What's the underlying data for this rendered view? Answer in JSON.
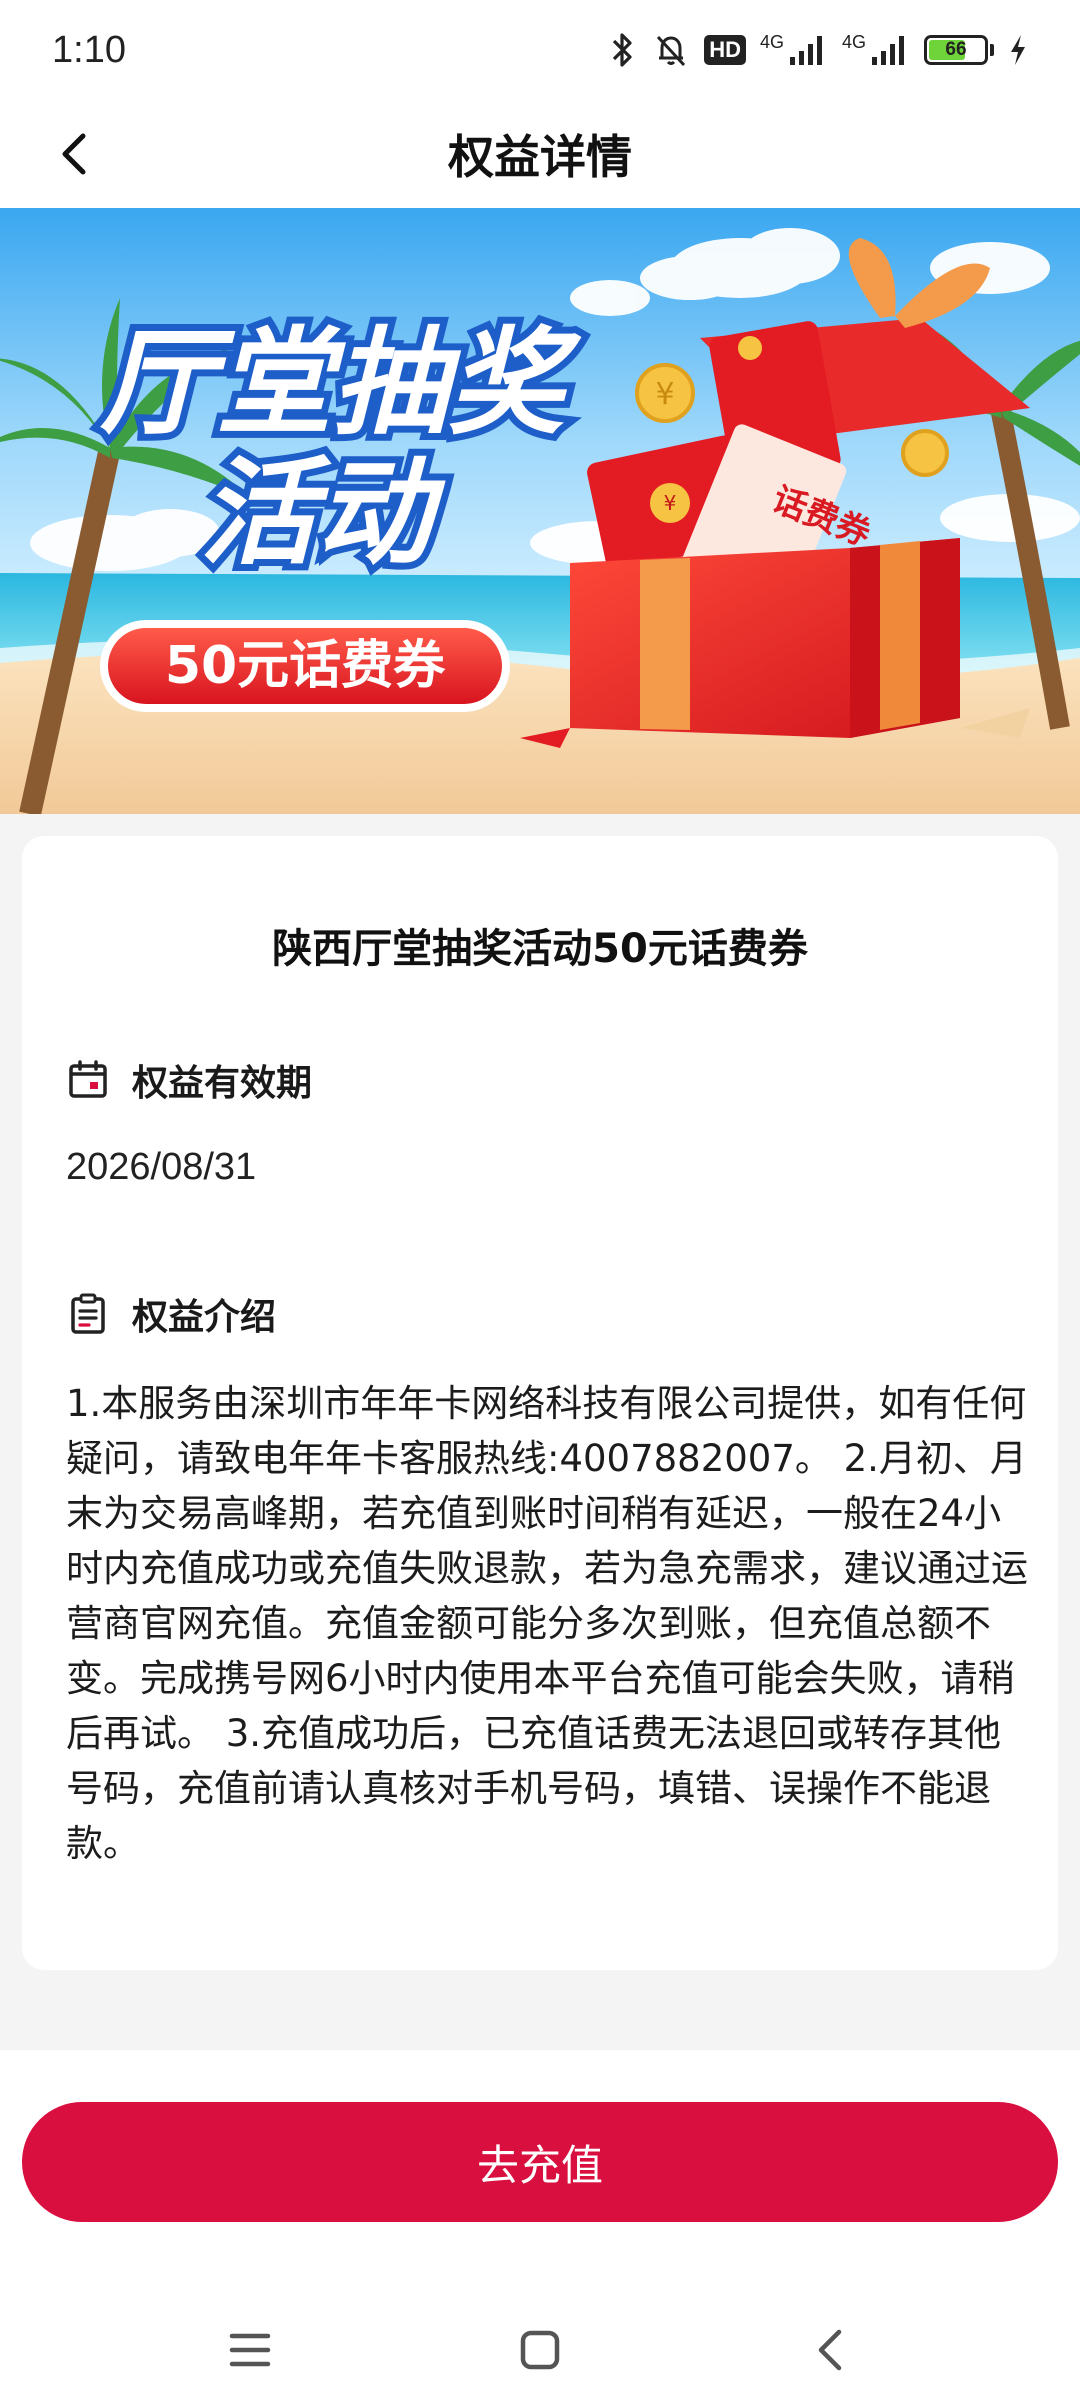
{
  "status_bar": {
    "time": "1:10",
    "hd_label": "HD",
    "network_1": "4G",
    "network_2": "4G",
    "battery_level": "66",
    "battery_fraction": 0.66
  },
  "header": {
    "title": "权益详情"
  },
  "banner": {
    "headline_line1": "厅堂抽奖",
    "headline_line2": "活动",
    "pill_text": "50元话费券",
    "ticket_text": "话费券",
    "coin_symbol": "¥"
  },
  "card": {
    "title": "陕西厅堂抽奖活动50元话费券",
    "validity": {
      "label": "权益有效期",
      "value": "2026/08/31"
    },
    "intro": {
      "label": "权益介绍",
      "text": "1.本服务由深圳市年年卡网络科技有限公司提供，如有任何疑问，请致电年年卡客服热线:4007882007。 2.月初、月末为交易高峰期，若充值到账时间稍有延迟，一般在24小时内充值成功或充值失败退款，若为急充需求，建议通过运营商官网充值。充值金额可能分多次到账，但充值总额不变。完成携号网6小时内使用本平台充值可能会失败，请稍后再试。 3.充值成功后，已充值话费无法退回或转存其他号码，充值前请认真核对手机号码，填错、误操作不能退款。"
    }
  },
  "action": {
    "recharge_label": "去充值"
  },
  "colors": {
    "accent": "#d90f3f",
    "banner_pill": "#e8262b",
    "battery": "#6fd43a"
  },
  "icons": {
    "back": "chevron-left-icon",
    "calendar": "calendar-icon",
    "clipboard": "clipboard-icon",
    "nav_menu": "menu-icon",
    "nav_home": "square-icon",
    "nav_back": "chevron-left-icon"
  }
}
